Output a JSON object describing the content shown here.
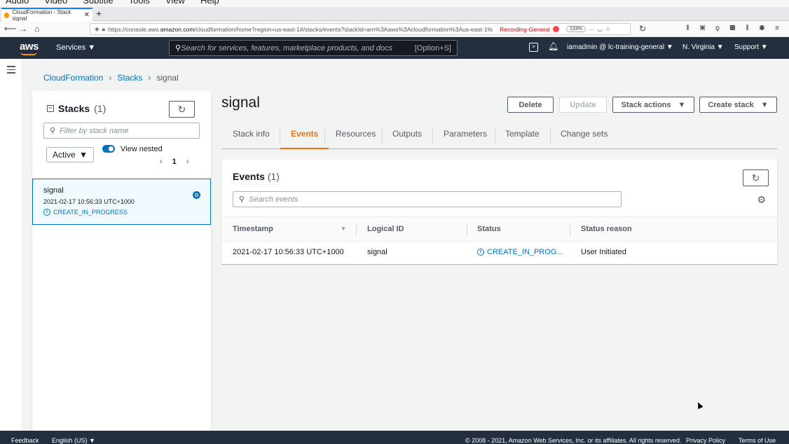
{
  "browser": {
    "menu": [
      "Audio",
      "Video",
      "Subtitle",
      "Tools",
      "View",
      "Help"
    ],
    "tab_title": "CloudFormation - Stack signal",
    "url_prefix": "https://console.aws.",
    "url_domain": "amazon.com",
    "url_rest": "/cloudformation/home?region=us-east-1#/stacks/events?stackId=arn%3Aaws%3Acloudformation%3Aus-east-1%",
    "recording": "Recording-General",
    "zoom": "133%"
  },
  "aws": {
    "logo": "aws",
    "services": "Services ▼",
    "search_placeholder": "Search for services, features, marketplace products, and docs",
    "search_shortcut": "[Option+S]",
    "account": "iamadmin @ lc-training-general ▼",
    "region": "N. Virginia ▼",
    "support": "Support ▼"
  },
  "breadcrumb": {
    "items": [
      "CloudFormation",
      "Stacks"
    ],
    "current": "signal"
  },
  "stacks_panel": {
    "title": "Stacks",
    "count": "(1)",
    "filter_placeholder": "Filter by stack name",
    "status_filter": "Active",
    "view_nested": "View nested",
    "page": "1",
    "stack": {
      "name": "signal",
      "time": "2021-02-17 10:56:33 UTC+1000",
      "status": "CREATE_IN_PROGRESS"
    }
  },
  "page": {
    "title": "signal",
    "buttons": {
      "delete": "Delete",
      "update": "Update",
      "stack_actions": "Stack actions",
      "create_stack": "Create stack"
    },
    "tabs": [
      "Stack info",
      "Events",
      "Resources",
      "Outputs",
      "Parameters",
      "Template",
      "Change sets"
    ],
    "active_tab": "Events"
  },
  "events": {
    "title": "Events",
    "count": "(1)",
    "search_placeholder": "Search events",
    "columns": [
      "Timestamp",
      "Logical ID",
      "Status",
      "Status reason"
    ],
    "rows": [
      {
        "timestamp": "2021-02-17 10:56:33 UTC+1000",
        "logical_id": "signal",
        "status": "CREATE_IN_PROG...",
        "reason": "User Initiated"
      }
    ]
  },
  "footer": {
    "feedback": "Feedback",
    "language": "English (US) ▼",
    "copyright": "© 2008 - 2021, Amazon Web Services, Inc. or its affiliates. All rights reserved.",
    "privacy": "Privacy Policy",
    "terms": "Terms of Use"
  },
  "colors": {
    "accent": "#ec7211",
    "link": "#0073bb",
    "header": "#232f3e"
  }
}
